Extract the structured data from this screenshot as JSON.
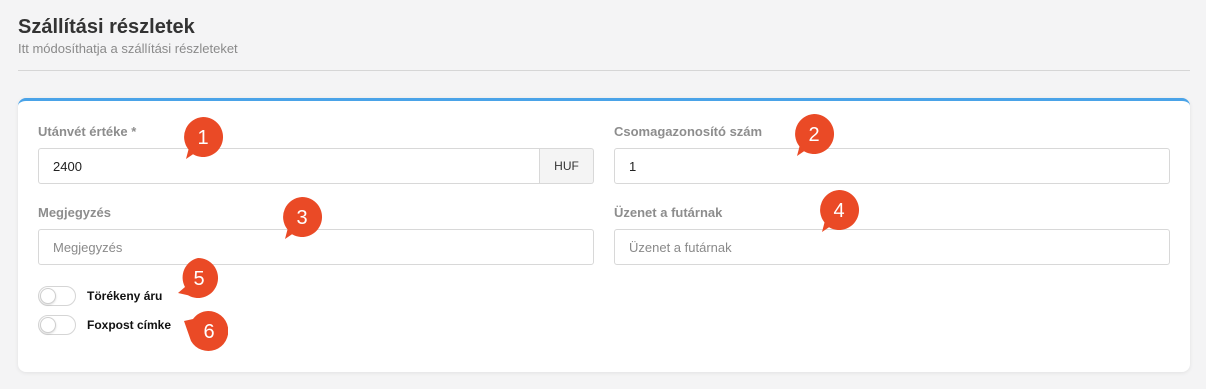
{
  "header": {
    "title": "Szállítási részletek",
    "subtitle": "Itt módosíthatja a szállítási részleteket"
  },
  "form": {
    "cod": {
      "label": "Utánvét értéke *",
      "value": "2400",
      "currency": "HUF"
    },
    "package_id": {
      "label": "Csomagazonosító szám",
      "value": "1"
    },
    "note": {
      "label": "Megjegyzés",
      "placeholder": "Megjegyzés"
    },
    "courier_message": {
      "label": "Üzenet a futárnak",
      "placeholder": "Üzenet a futárnak"
    },
    "fragile": {
      "label": "Törékeny áru",
      "on": false
    },
    "foxpost_label": {
      "label": "Foxpost címke",
      "on": false
    }
  },
  "markers": [
    "1",
    "2",
    "3",
    "4",
    "5",
    "6"
  ],
  "colors": {
    "accent_top_border": "#4aa3e8",
    "marker": "#ea4a26",
    "background": "#f4f4f5"
  }
}
